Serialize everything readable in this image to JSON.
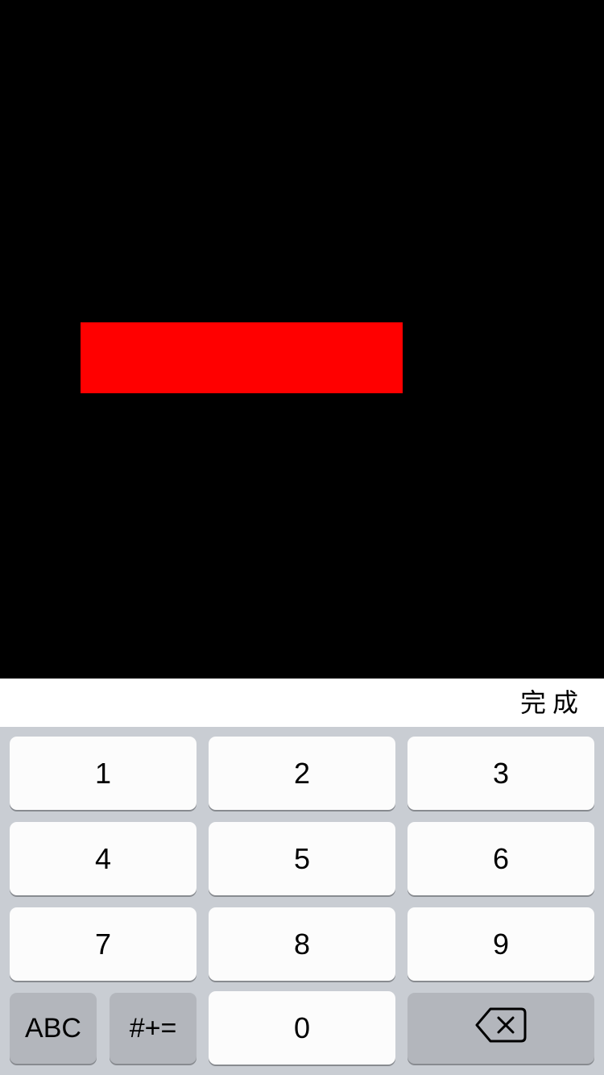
{
  "accessory_bar": {
    "done_label": "完成"
  },
  "keyboard": {
    "rows": [
      [
        "1",
        "2",
        "3"
      ],
      [
        "4",
        "5",
        "6"
      ],
      [
        "7",
        "8",
        "9"
      ]
    ],
    "bottom_row": {
      "abc_label": "ABC",
      "symbols_label": "#+=",
      "zero_label": "0",
      "delete_icon": "backspace-icon"
    }
  },
  "colors": {
    "background": "#000000",
    "red_block": "#ff0000",
    "keyboard_bg": "#c9cdd3",
    "key_bg": "#fcfcfc",
    "key_gray_bg": "#b3b6bc"
  }
}
